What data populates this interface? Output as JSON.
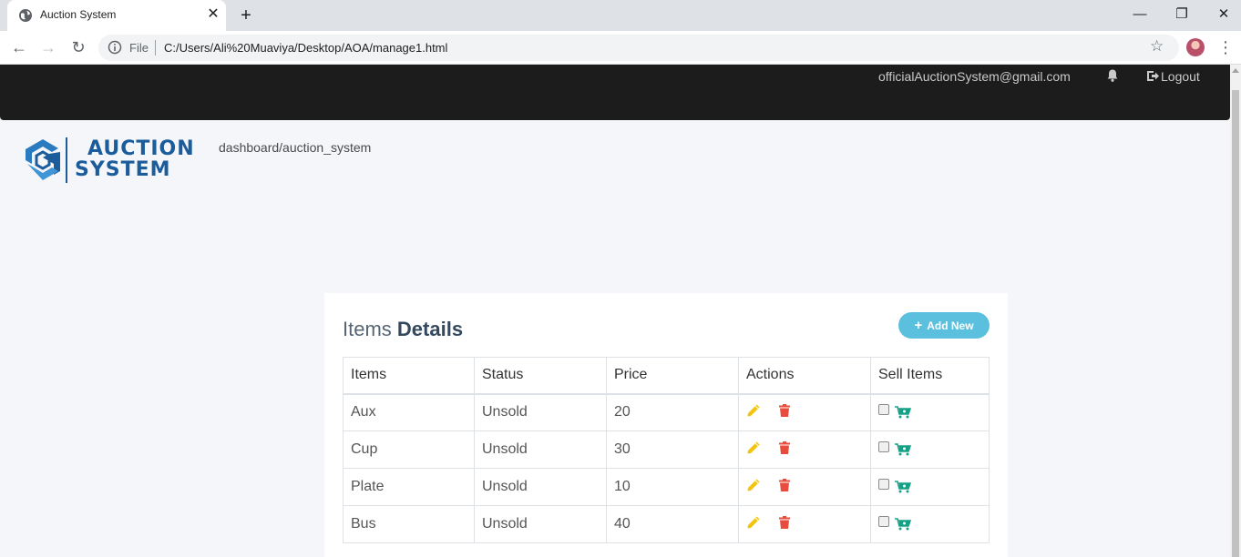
{
  "browser": {
    "tab_title": "Auction System",
    "url_scheme_label": "File",
    "url": "C:/Users/Ali%20Muaviya/Desktop/AOA/manage1.html"
  },
  "topnav": {
    "email": "officialAuctionSystem@gmail.com",
    "logout_label": "Logout"
  },
  "logo": {
    "line1": "AUCTION",
    "line2": "SYSTEM"
  },
  "breadcrumb": "dashboard/auction_system",
  "card": {
    "title_prefix": "Items",
    "title_bold": "Details",
    "add_button_label": "Add New"
  },
  "table": {
    "headers": [
      "Items",
      "Status",
      "Price",
      "Actions",
      "Sell Items"
    ],
    "rows": [
      {
        "item": "Aux",
        "status": "Unsold",
        "price": "20"
      },
      {
        "item": "Cup",
        "status": "Unsold",
        "price": "30"
      },
      {
        "item": "Plate",
        "status": "Unsold",
        "price": "10"
      },
      {
        "item": "Bus",
        "status": "Unsold",
        "price": "40"
      }
    ]
  },
  "colors": {
    "navbar": "#1c1c1c",
    "brand_blue": "#1b5c9b",
    "add_button": "#5bc0de",
    "edit_icon": "#f1c40f",
    "delete_icon": "#e74c3c",
    "cart_icon": "#16a085"
  },
  "icons": {
    "edit": "pencil-icon",
    "delete": "trash-icon",
    "sell": "cart-icon",
    "notifications": "bell-icon",
    "logout": "logout-icon"
  }
}
